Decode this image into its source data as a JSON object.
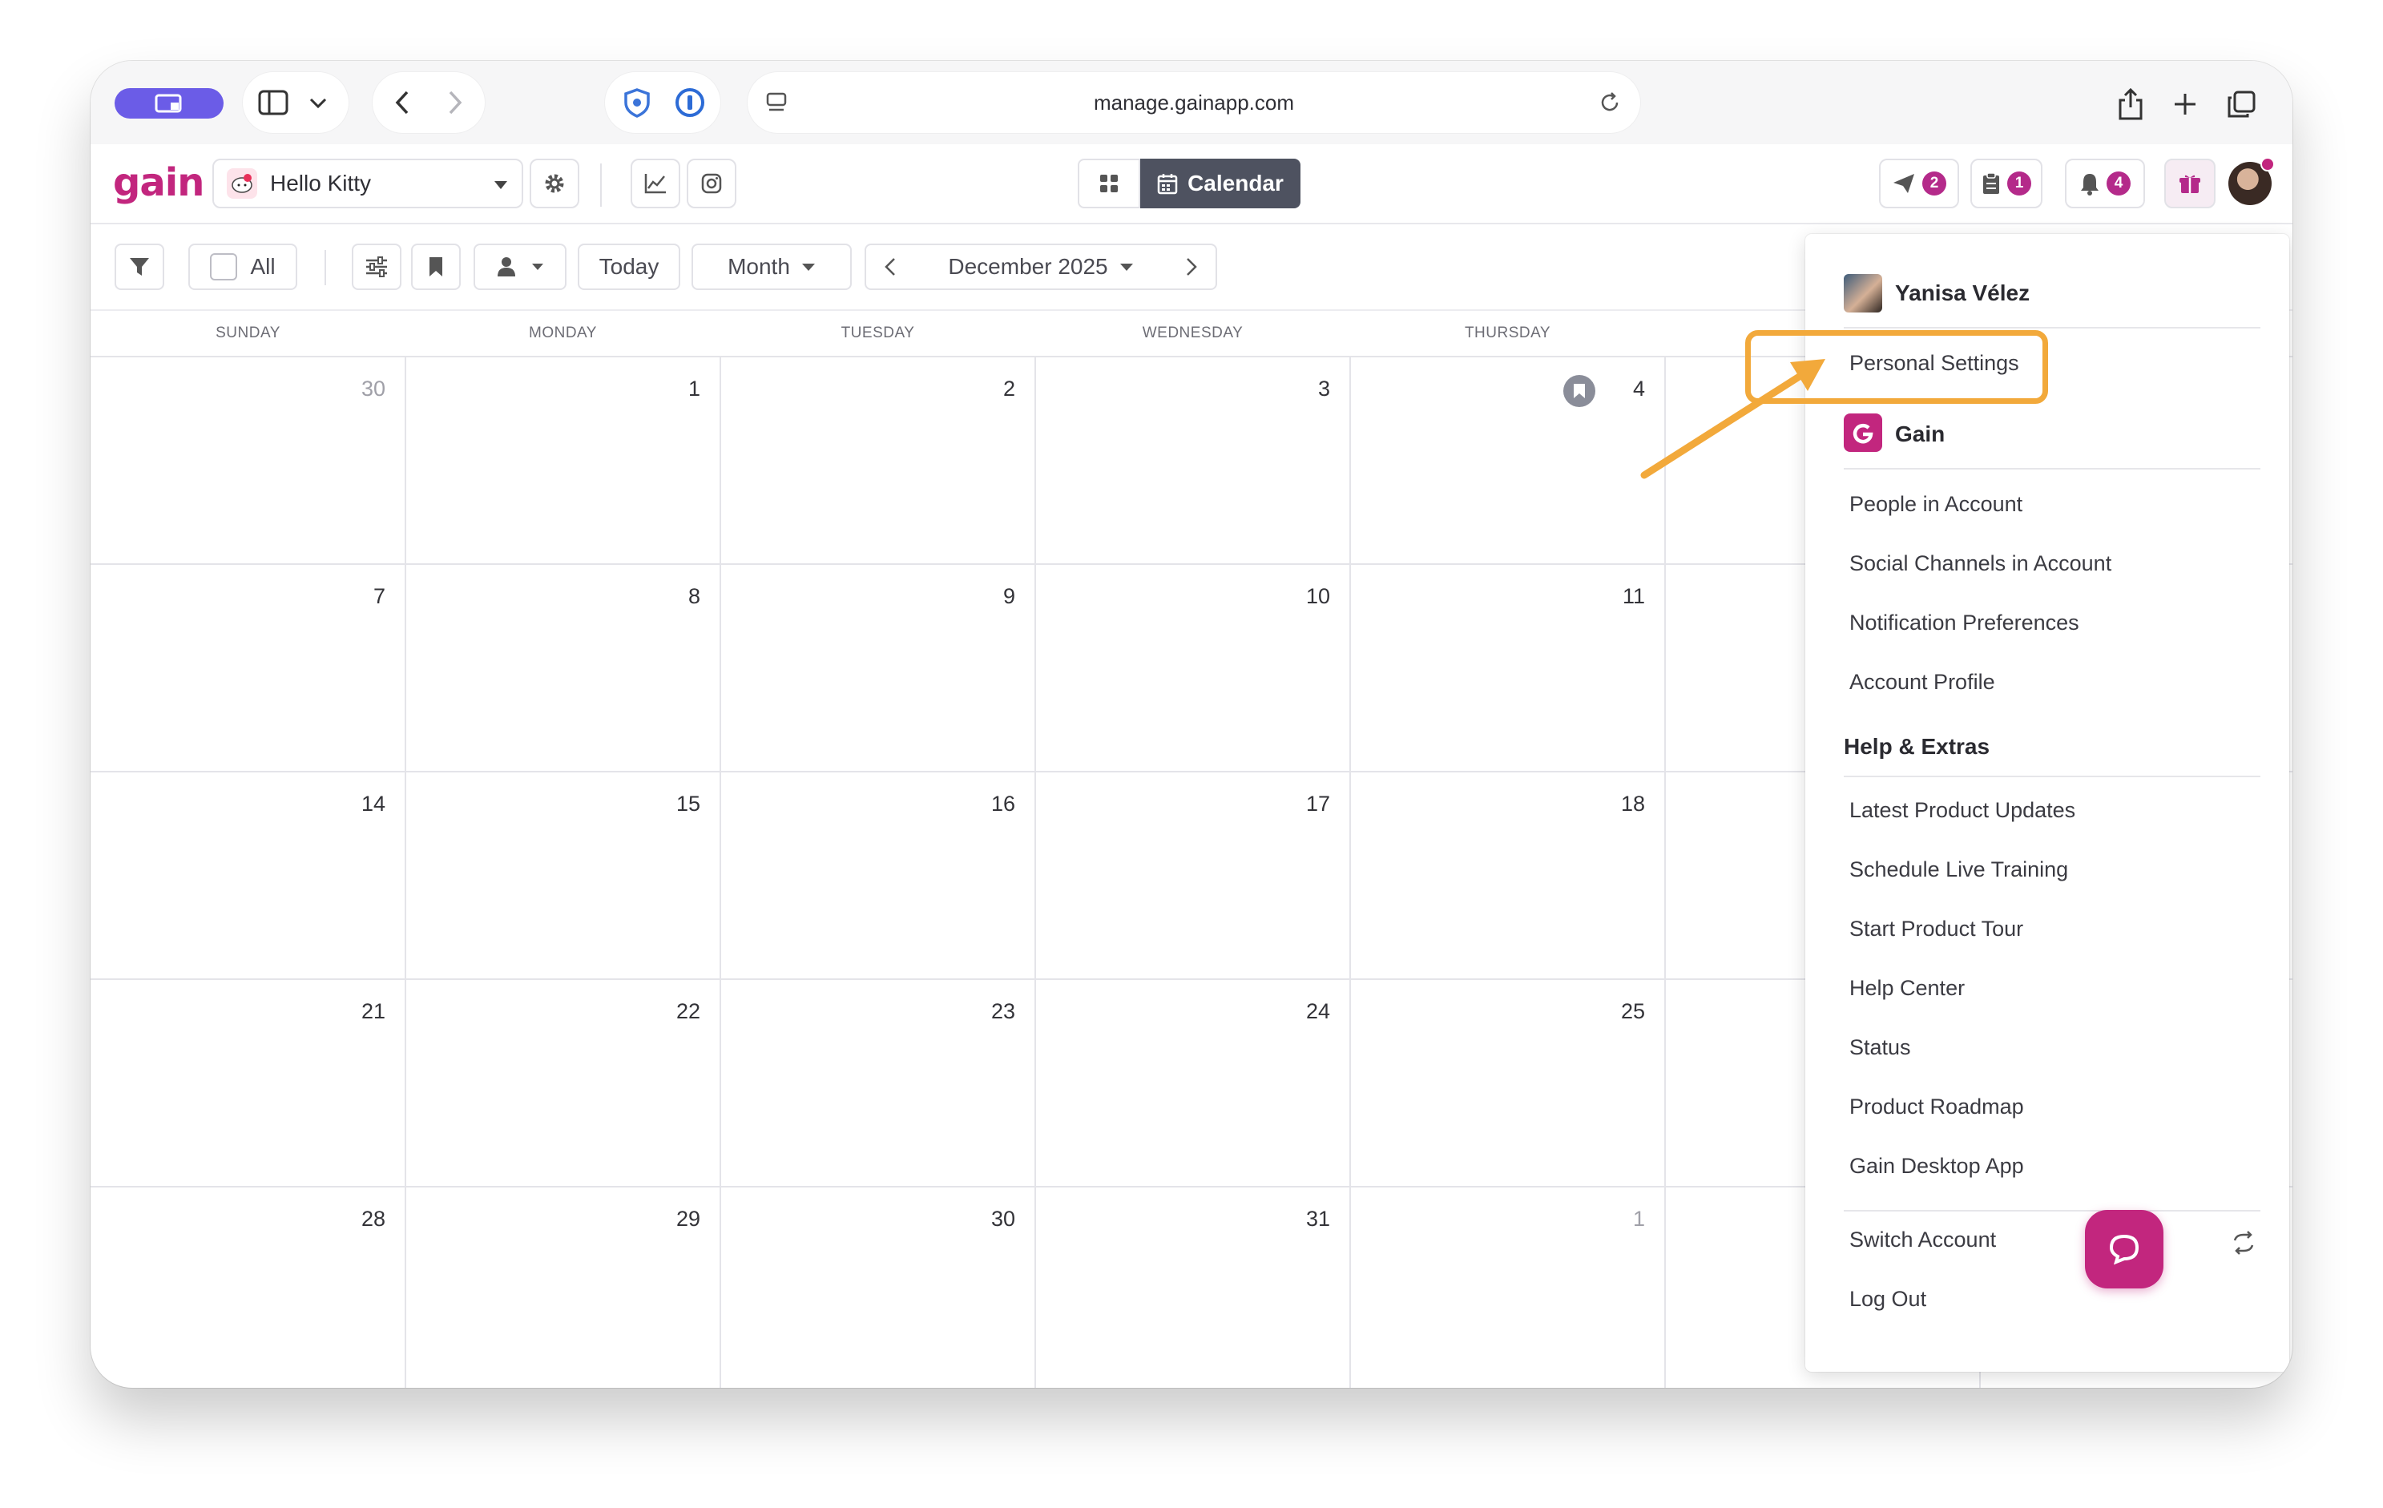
{
  "browser": {
    "url": "manage.gainapp.com"
  },
  "header": {
    "logo": "gain",
    "client_name": "Hello Kitty",
    "view_toggle_label": "Calendar",
    "notifications": {
      "sends": "2",
      "tasks": "1",
      "bell": "4"
    },
    "brand_color": "#c2267e"
  },
  "toolbar": {
    "all_label": "All",
    "today_label": "Today",
    "view_select": "Month",
    "month_label": "December 2025"
  },
  "calendar": {
    "weekdays": [
      "SUNDAY",
      "MONDAY",
      "TUESDAY",
      "WEDNESDAY",
      "THURSDAY",
      "FI"
    ],
    "weeks": [
      [
        "30",
        "1",
        "2",
        "3",
        "4"
      ],
      [
        "7",
        "8",
        "9",
        "10",
        "11"
      ],
      [
        "14",
        "15",
        "16",
        "17",
        "18"
      ],
      [
        "21",
        "22",
        "23",
        "24",
        "25"
      ],
      [
        "28",
        "29",
        "30",
        "31",
        "1"
      ]
    ]
  },
  "menu": {
    "user_name": "Yanisa Vélez",
    "personal_settings": "Personal Settings",
    "account_name": "Gain",
    "account_items": [
      "People in Account",
      "Social Channels in Account",
      "Notification Preferences",
      "Account Profile"
    ],
    "help_heading": "Help & Extras",
    "help_items": [
      "Latest Product Updates",
      "Schedule Live Training",
      "Start Product Tour",
      "Help Center",
      "Status",
      "Product Roadmap",
      "Gain Desktop App"
    ],
    "switch_account": "Switch Account",
    "log_out": "Log Out",
    "highlight_color": "#f2a93b"
  }
}
